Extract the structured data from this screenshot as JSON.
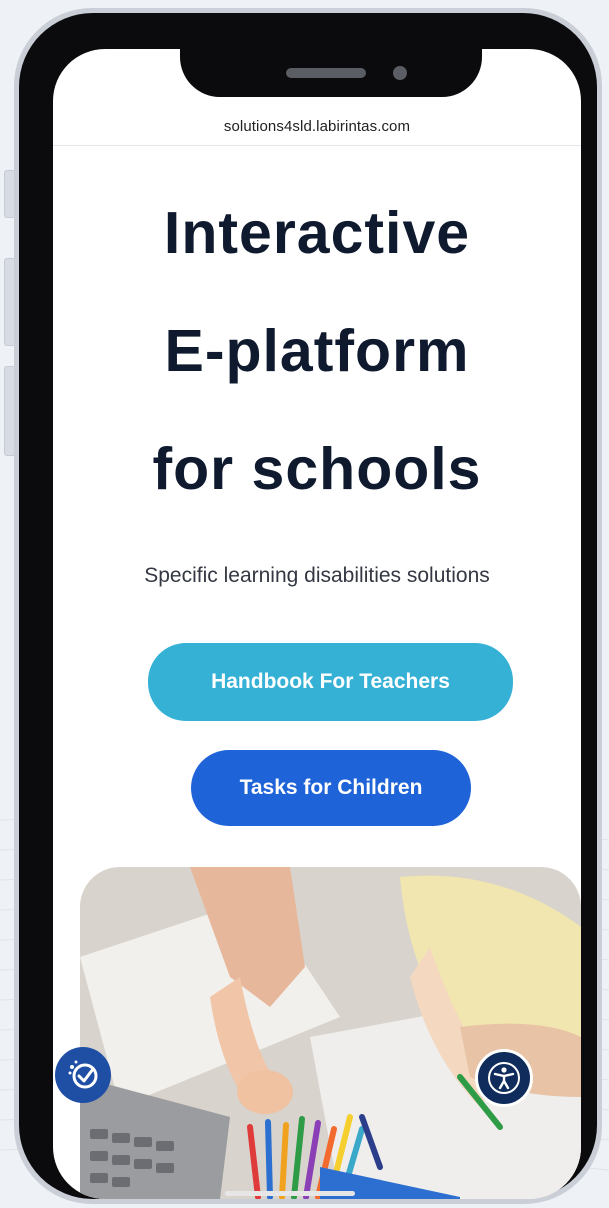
{
  "browser": {
    "url": "solutions4sld.labirintas.com"
  },
  "hero": {
    "title_lines": [
      "Interactive",
      "E-platform",
      "for schools"
    ],
    "subtitle": "Specific learning disabilities solutions"
  },
  "buttons": {
    "teachers_label": "Handbook For Teachers",
    "children_label": "Tasks for Children"
  },
  "image": {
    "subject": "children drawing with colored pencils"
  },
  "floating": {
    "left_icon": "magic-check-icon",
    "right_icon": "accessibility-icon"
  },
  "colors": {
    "title": "#0f1a2f",
    "teachers_button": "#36b1d6",
    "children_button": "#1f63d8",
    "accessibility_button": "#0f2c5c",
    "left_button": "#1e4fa5"
  }
}
